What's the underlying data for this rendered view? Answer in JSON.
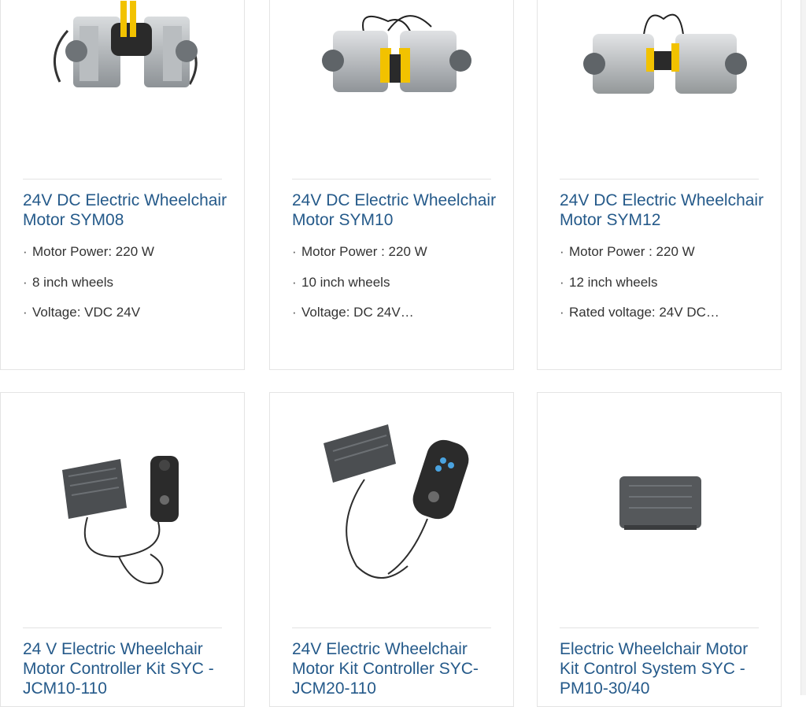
{
  "products": [
    {
      "title": "24V DC Electric Wheelchair Motor SYM08",
      "image": "motor-sym08-icon",
      "specs": [
        "Motor Power: 220 W",
        "8 inch wheels",
        "Voltage: VDC 24V"
      ]
    },
    {
      "title": "24V DC Electric Wheelchair Motor SYM10",
      "image": "motor-sym10-icon",
      "specs": [
        "Motor Power : 220 W",
        "10 inch wheels",
        "Voltage: DC 24V…"
      ]
    },
    {
      "title": "24V DC Electric Wheelchair Motor SYM12",
      "image": "motor-sym12-icon",
      "specs": [
        "Motor Power : 220 W",
        "12 inch wheels",
        "Rated voltage: 24V DC…"
      ]
    },
    {
      "title": "24 V Electric Wheelchair Motor Controller Kit SYC - JCM10-110",
      "image": "controller-kit-jcm10-icon",
      "specs": []
    },
    {
      "title": "24V Electric Wheelchair Motor Kit Controller SYC-JCM20-110",
      "image": "controller-kit-jcm20-icon",
      "specs": []
    },
    {
      "title": "Electric Wheelchair Motor Kit Control System SYC - PM10-30/40",
      "image": "control-box-pm10-icon",
      "specs": []
    }
  ],
  "colors": {
    "title": "#255a8a",
    "border": "#e4e4e4",
    "text": "#333333"
  }
}
